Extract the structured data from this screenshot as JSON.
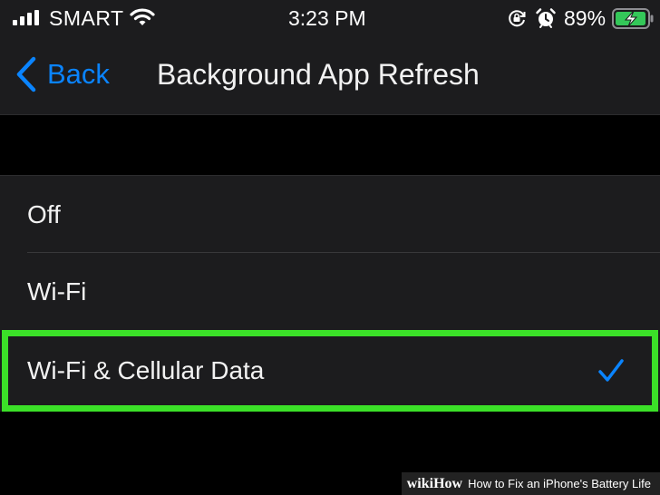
{
  "status_bar": {
    "carrier": "SMART",
    "time": "3:23 PM",
    "battery_percent": "89%",
    "icons": [
      "signal-icon",
      "wifi-icon",
      "rotation-lock-icon",
      "alarm-icon",
      "battery-charging-icon"
    ]
  },
  "nav": {
    "back_label": "Back",
    "title": "Background App Refresh"
  },
  "options": [
    {
      "label": "Off",
      "selected": false
    },
    {
      "label": "Wi-Fi",
      "selected": false
    },
    {
      "label": "Wi-Fi & Cellular Data",
      "selected": true
    }
  ],
  "colors": {
    "accent": "#0a84ff",
    "highlight": "#3be028",
    "background": "#000000",
    "panel": "#1c1c1e"
  },
  "watermark": {
    "logo": "wikiHow",
    "text": "How to Fix an iPhone's Battery Life"
  }
}
